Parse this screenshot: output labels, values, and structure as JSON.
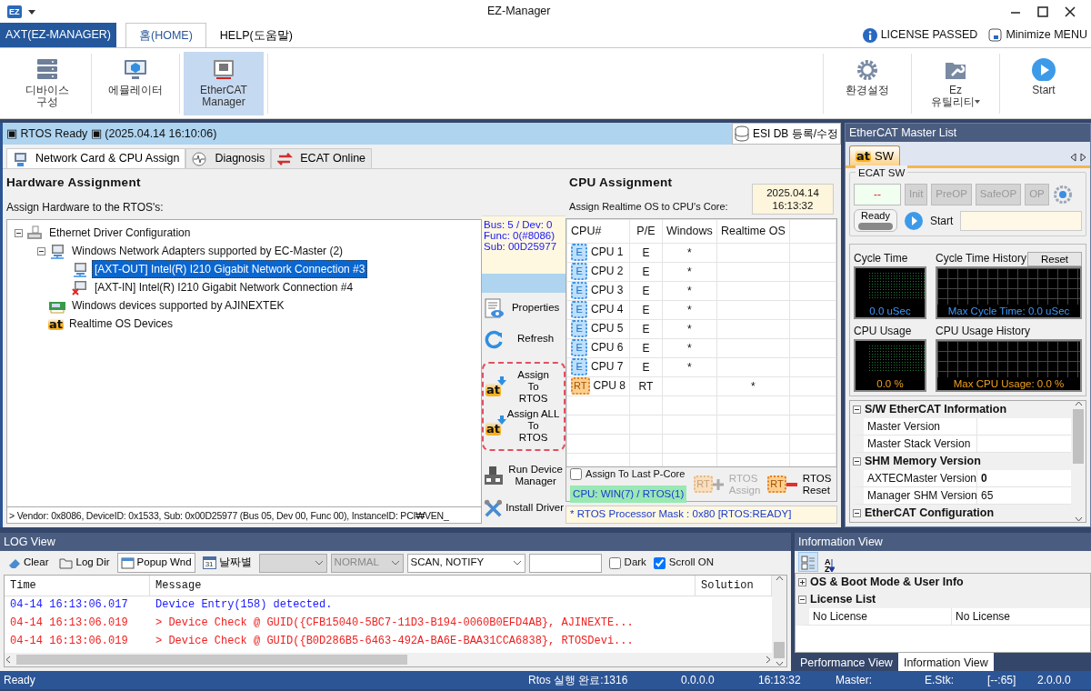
{
  "window": {
    "app_icon": "EZ",
    "title": "EZ-Manager"
  },
  "ribbon": {
    "app_button": "AXT(EZ-MANAGER)",
    "tabs": [
      {
        "label": "홈(HOME)",
        "selected": true
      },
      {
        "label": "HELP(도움말)",
        "selected": false
      }
    ],
    "license_status": "LICENSE PASSED",
    "minimize_menu": "Minimize MENU",
    "left_buttons": [
      {
        "label": "디바이스\n구성",
        "selected": false,
        "dropdown": false
      },
      {
        "label": "에뮬레이터",
        "selected": false,
        "dropdown": false
      },
      {
        "label": "EtherCAT\nManager",
        "selected": true,
        "dropdown": false
      }
    ],
    "right_buttons": [
      {
        "label": "환경설정",
        "selected": false,
        "dropdown": false
      },
      {
        "label": "Ez\n유틸리티",
        "selected": false,
        "dropdown": true
      },
      {
        "label": "Start",
        "selected": false,
        "dropdown": false
      }
    ]
  },
  "rtos_status": {
    "text": "▣ RTOS Ready ▣ (2025.04.14 16:10:06)",
    "esi_button": "ESI DB 등록/수정"
  },
  "view_tabs": [
    {
      "label": "Network Card & CPU Assign",
      "selected": true
    },
    {
      "label": "Diagnosis",
      "selected": false
    },
    {
      "label": "ECAT Online",
      "selected": false
    }
  ],
  "hardware": {
    "title": "Hardware Assignment",
    "subtitle": "Assign Hardware to the RTOS's:",
    "tree": [
      {
        "label": "Ethernet Driver Configuration",
        "kind": "ethernet",
        "selected": false,
        "expanded": true,
        "children": [
          {
            "label": "Windows Network Adapters supported by EC-Master (2)",
            "kind": "network",
            "selected": false,
            "expanded": true,
            "children": [
              {
                "label": "[AXT-OUT] Intel(R) I210 Gigabit Network Connection #3",
                "kind": "adapter",
                "selected": true
              },
              {
                "label": "[AXT-IN] Intel(R) I210 Gigabit Network Connection #4",
                "kind": "adapter-error",
                "selected": false
              }
            ]
          },
          {
            "label": "Windows devices supported by AJINEXTEK",
            "kind": "pci",
            "selected": false
          },
          {
            "label": "Realtime OS Devices",
            "kind": "rtos",
            "icon_text": "at",
            "selected": false
          }
        ]
      }
    ],
    "device_info": [
      "Bus: 5 / Dev: 0",
      "Func: 0(#8086)",
      "Sub: 00D25977"
    ],
    "vendor_line": "> Vendor: 0x8086, DeviceID: 0x1533, Sub: 0x00D25977 (Bus 05, Dev 00, Func 00), InstanceID: PCI₩VEN_"
  },
  "actions": [
    {
      "label": "Properties",
      "kind": "properties"
    },
    {
      "label": "Refresh",
      "kind": "refresh"
    },
    {
      "label": "Assign\nTo\nRTOS",
      "kind": "assign",
      "icon_text": "at"
    },
    {
      "label": "Assign ALL\nTo\nRTOS",
      "kind": "assign-all",
      "icon_text": "at"
    },
    {
      "label": "Run Device\nManager",
      "kind": "device-manager"
    },
    {
      "label": "Install Driver",
      "kind": "install"
    }
  ],
  "cpu": {
    "title": "CPU Assignment",
    "subtitle": "Assign Realtime OS to CPU's Core:",
    "datetime": "2025.04.14\n16:13:32",
    "columns": [
      "CPU#",
      "P/E",
      "Windows",
      "Realtime OS"
    ],
    "rows": [
      {
        "kind": "e",
        "chip": "E",
        "cpu": "CPU 1",
        "pe": "E",
        "windows": "*"
      },
      {
        "kind": "e",
        "chip": "E",
        "cpu": "CPU 2",
        "pe": "E",
        "windows": "*"
      },
      {
        "kind": "e",
        "chip": "E",
        "cpu": "CPU 3",
        "pe": "E",
        "windows": "*"
      },
      {
        "kind": "e",
        "chip": "E",
        "cpu": "CPU 4",
        "pe": "E",
        "windows": "*"
      },
      {
        "kind": "e",
        "chip": "E",
        "cpu": "CPU 5",
        "pe": "E",
        "windows": "*"
      },
      {
        "kind": "e",
        "chip": "E",
        "cpu": "CPU 6",
        "pe": "E",
        "windows": "*"
      },
      {
        "kind": "e",
        "chip": "E",
        "cpu": "CPU 7",
        "pe": "E",
        "windows": "*"
      },
      {
        "kind": "rt",
        "chip": "RT",
        "cpu": "CPU 8",
        "pe": "RT",
        "realtime_os": "*"
      }
    ],
    "last_p_core": {
      "label": "Assign To Last P-Core",
      "checked": false
    },
    "summary": "CPU: WIN(7) / RTOS(1)",
    "buttons": [
      {
        "label": "RTOS\nAssign",
        "chip": "RT",
        "kind": "assign",
        "disabled": true
      },
      {
        "label": "RTOS\nReset",
        "chip": "RT",
        "kind": "reset",
        "disabled": false
      }
    ],
    "mask": "* RTOS Processor Mask : 0x80 [RTOS:READY]"
  },
  "master": {
    "title": "EtherCAT Master List",
    "tabs": [
      {
        "icon_text": "at",
        "label": "SW",
        "selected": true
      }
    ],
    "group_title": "ECAT SW",
    "state": "--",
    "state_buttons": [
      {
        "label": "Init",
        "disabled": true
      },
      {
        "label": "PreOP",
        "disabled": true
      },
      {
        "label": "SafeOP",
        "disabled": true
      },
      {
        "label": "OP",
        "disabled": true
      }
    ],
    "ready": "Ready",
    "start": "Start",
    "monitors": [
      {
        "title": "Cycle Time",
        "kind": "gauge",
        "reading": "0.0 uSec"
      },
      {
        "title": "Cycle Time History",
        "kind": "history",
        "reading": "Max Cycle Time: 0.0 uSec",
        "reset": "Reset"
      },
      {
        "title": "CPU Usage",
        "kind": "gauge",
        "reading": "0.0 %"
      },
      {
        "title": "CPU Usage History",
        "kind": "history",
        "reading": "Max CPU Usage: 0.0 %"
      }
    ],
    "properties": [
      {
        "category": "S/W EtherCAT Information",
        "expanded": true,
        "rows": [
          {
            "name": "Master Version"
          },
          {
            "name": "Master Stack Version"
          }
        ]
      },
      {
        "category": "SHM Memory Version",
        "expanded": true,
        "rows": [
          {
            "name": "AXTECMaster Version",
            "value": "0",
            "modified": true
          },
          {
            "name": "Manager SHM Version",
            "value": "65",
            "modified": false
          }
        ]
      },
      {
        "category": "EtherCAT Configuration",
        "expanded": true
      }
    ]
  },
  "log": {
    "title": "LOG View",
    "toolbar": [
      {
        "label": "Clear",
        "kind": "clear",
        "selected": false
      },
      {
        "label": "Log Dir",
        "kind": "folder",
        "selected": false
      },
      {
        "label": "Popup Wnd",
        "kind": "popup",
        "selected": true
      },
      {
        "label": "날짜별",
        "kind": "calendar",
        "icon_text": "31",
        "selected": false
      }
    ],
    "filters": [
      {
        "kind": "combo",
        "disabled": true
      },
      {
        "kind": "combo",
        "value": "NORMAL",
        "disabled": true
      },
      {
        "kind": "combo",
        "value": "SCAN, NOTIFY",
        "disabled": false
      },
      {
        "kind": "text"
      }
    ],
    "checkboxes": [
      {
        "label": "Dark",
        "checked": false
      },
      {
        "label": "Scroll ON",
        "checked": true
      }
    ],
    "columns": [
      "Time",
      "Message",
      "Solution"
    ],
    "rows": [
      {
        "time": "04-14 16:13:06.017",
        "message": "Device Entry(158) detected.",
        "color": "#1a1aff"
      },
      {
        "time": "04-14 16:13:06.019",
        "message": "> Device Check @ GUID({CFB15040-5BC7-11D3-B194-0060B0EFD4AB}, AJINEXTE...",
        "color": "#f02020"
      },
      {
        "time": "04-14 16:13:06.019",
        "message": "> Device Check @ GUID({B0D286B5-6463-492A-BA6E-BAA31CCA6838}, RTOSDevi...",
        "color": "#f02020"
      }
    ]
  },
  "info": {
    "title": "Information View",
    "toolbar": [
      {
        "kind": "categorized",
        "selected": true
      },
      {
        "kind": "alphabetical",
        "icon_text": "AZ",
        "selected": false
      }
    ],
    "properties": [
      {
        "category": "OS & Boot Mode & User Info",
        "expanded": false
      },
      {
        "category": "License List",
        "expanded": true,
        "rows": [
          {
            "name": "No License",
            "value": "No License"
          }
        ]
      }
    ],
    "tabs": [
      {
        "label": "Performance View",
        "selected": false
      },
      {
        "label": "Information View",
        "selected": true
      }
    ]
  },
  "status_bar": [
    "Ready",
    "Rtos 실행 완료:1316",
    "0.0.0.0",
    "16:13:32",
    "Master:",
    "E.Stk:",
    "[--:65]",
    "2.0.0.0"
  ]
}
